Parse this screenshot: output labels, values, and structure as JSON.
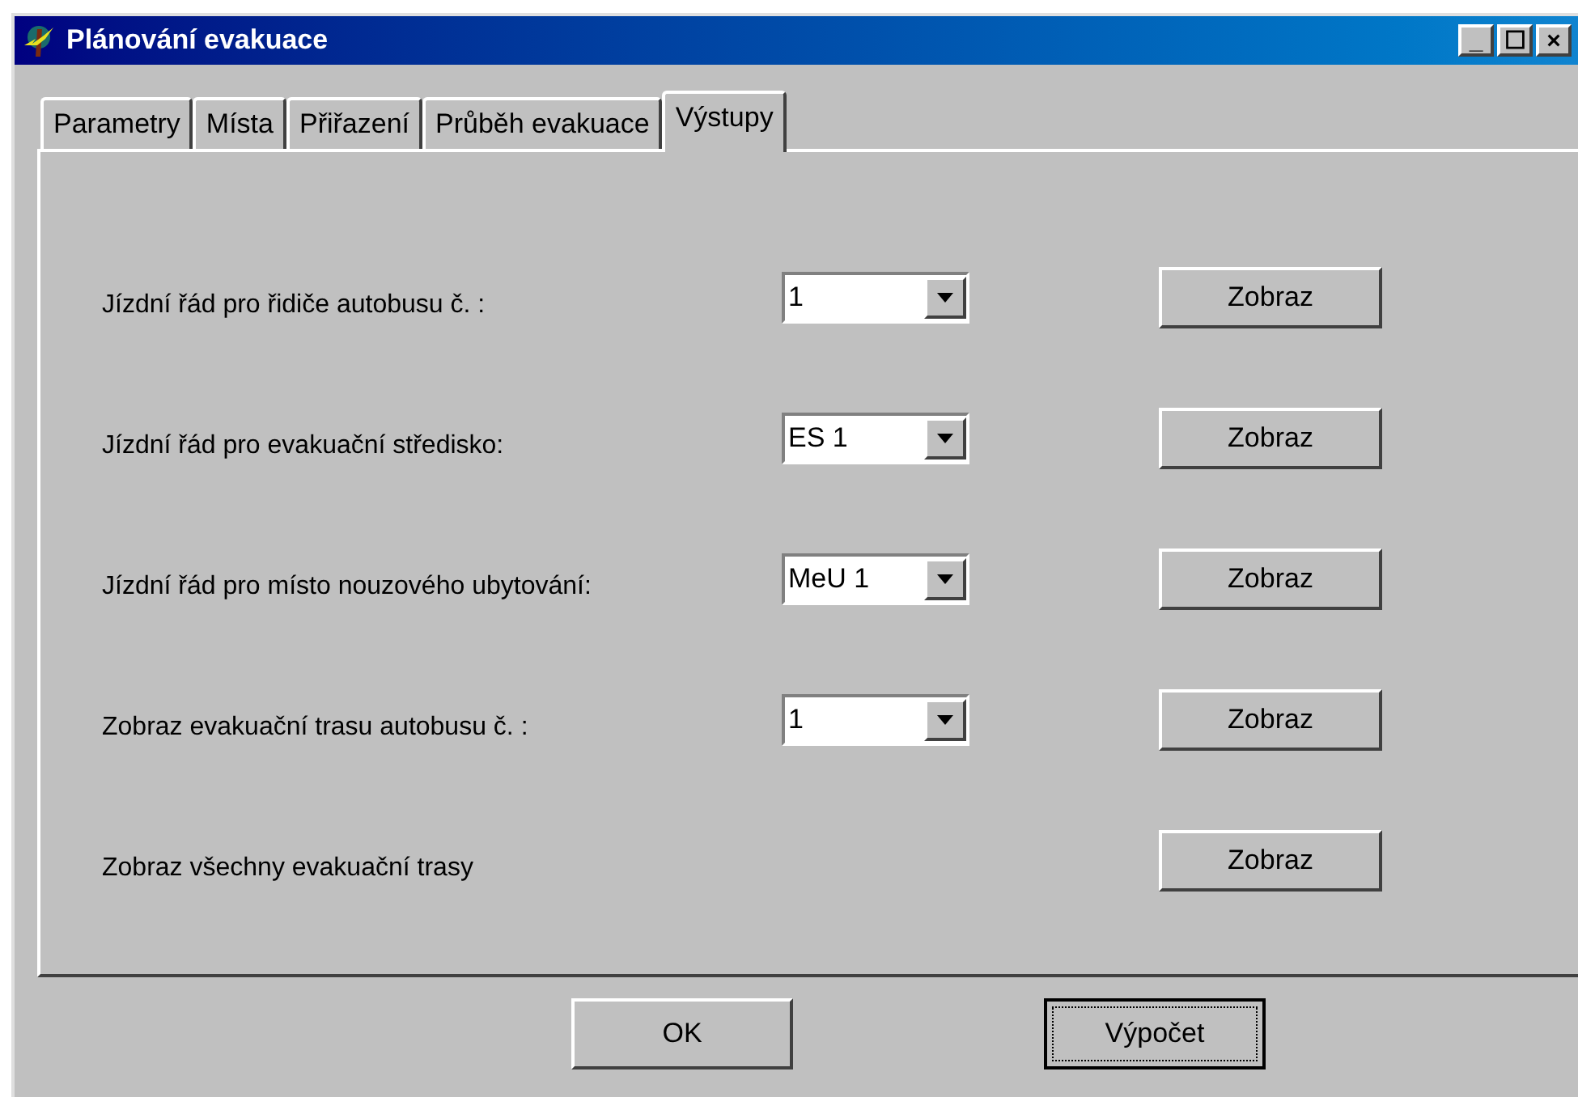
{
  "window": {
    "title": "Plánování evakuace",
    "controls": [
      "_",
      "☐",
      "×"
    ]
  },
  "tabs": [
    {
      "label": "Parametry",
      "selected": false
    },
    {
      "label": "Místa",
      "selected": false
    },
    {
      "label": "Přiřazení",
      "selected": false
    },
    {
      "label": "Průběh evakuace",
      "selected": false
    },
    {
      "label": "Výstupy",
      "selected": true
    }
  ],
  "rows": [
    {
      "kind": "combo",
      "label": "Jízdní řád pro řidiče autobusu č. :",
      "value": "1",
      "button": "Zobraz"
    },
    {
      "kind": "combo",
      "label": "Jízdní řád pro evakuační středisko:",
      "value": "ES 1",
      "button": "Zobraz"
    },
    {
      "kind": "combo",
      "label": "Jízdní řád pro místo nouzového ubytování:",
      "value": "MeU 1",
      "button": "Zobraz"
    },
    {
      "kind": "combo",
      "label": "Zobraz evakuační trasu autobusu č. :",
      "value": "1",
      "button": "Zobraz"
    },
    {
      "kind": "plain",
      "label": "Zobraz všechny evakuační trasy",
      "button": "Zobraz"
    }
  ],
  "buttons": [
    {
      "label": "OK",
      "focused": false
    },
    {
      "label": "Výpočet",
      "focused": true
    }
  ]
}
